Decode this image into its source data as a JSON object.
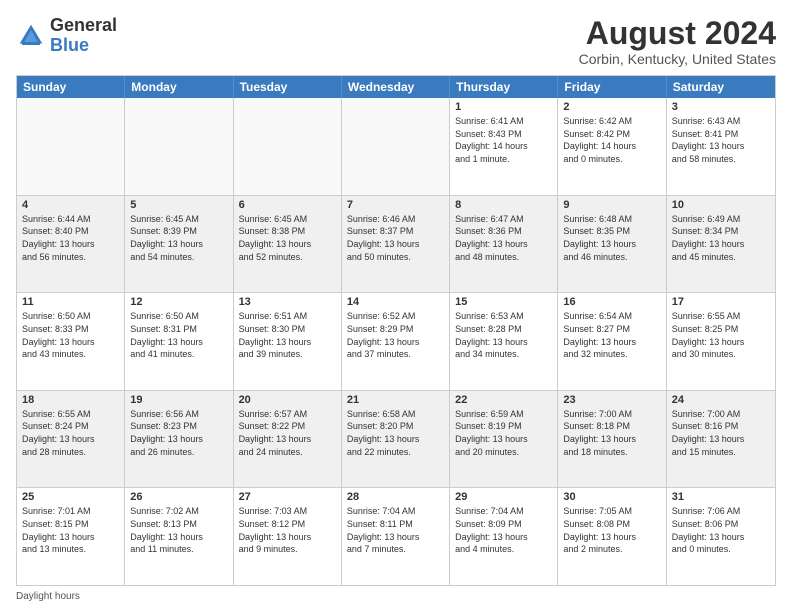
{
  "logo": {
    "general": "General",
    "blue": "Blue"
  },
  "header": {
    "month_year": "August 2024",
    "location": "Corbin, Kentucky, United States"
  },
  "days_of_week": [
    "Sunday",
    "Monday",
    "Tuesday",
    "Wednesday",
    "Thursday",
    "Friday",
    "Saturday"
  ],
  "weeks": [
    [
      {
        "day": "",
        "info": "",
        "empty": true
      },
      {
        "day": "",
        "info": "",
        "empty": true
      },
      {
        "day": "",
        "info": "",
        "empty": true
      },
      {
        "day": "",
        "info": "",
        "empty": true
      },
      {
        "day": "1",
        "info": "Sunrise: 6:41 AM\nSunset: 8:43 PM\nDaylight: 14 hours\nand 1 minute.",
        "empty": false
      },
      {
        "day": "2",
        "info": "Sunrise: 6:42 AM\nSunset: 8:42 PM\nDaylight: 14 hours\nand 0 minutes.",
        "empty": false
      },
      {
        "day": "3",
        "info": "Sunrise: 6:43 AM\nSunset: 8:41 PM\nDaylight: 13 hours\nand 58 minutes.",
        "empty": false
      }
    ],
    [
      {
        "day": "4",
        "info": "Sunrise: 6:44 AM\nSunset: 8:40 PM\nDaylight: 13 hours\nand 56 minutes.",
        "empty": false,
        "shaded": true
      },
      {
        "day": "5",
        "info": "Sunrise: 6:45 AM\nSunset: 8:39 PM\nDaylight: 13 hours\nand 54 minutes.",
        "empty": false,
        "shaded": true
      },
      {
        "day": "6",
        "info": "Sunrise: 6:45 AM\nSunset: 8:38 PM\nDaylight: 13 hours\nand 52 minutes.",
        "empty": false,
        "shaded": true
      },
      {
        "day": "7",
        "info": "Sunrise: 6:46 AM\nSunset: 8:37 PM\nDaylight: 13 hours\nand 50 minutes.",
        "empty": false,
        "shaded": true
      },
      {
        "day": "8",
        "info": "Sunrise: 6:47 AM\nSunset: 8:36 PM\nDaylight: 13 hours\nand 48 minutes.",
        "empty": false,
        "shaded": true
      },
      {
        "day": "9",
        "info": "Sunrise: 6:48 AM\nSunset: 8:35 PM\nDaylight: 13 hours\nand 46 minutes.",
        "empty": false,
        "shaded": true
      },
      {
        "day": "10",
        "info": "Sunrise: 6:49 AM\nSunset: 8:34 PM\nDaylight: 13 hours\nand 45 minutes.",
        "empty": false,
        "shaded": true
      }
    ],
    [
      {
        "day": "11",
        "info": "Sunrise: 6:50 AM\nSunset: 8:33 PM\nDaylight: 13 hours\nand 43 minutes.",
        "empty": false
      },
      {
        "day": "12",
        "info": "Sunrise: 6:50 AM\nSunset: 8:31 PM\nDaylight: 13 hours\nand 41 minutes.",
        "empty": false
      },
      {
        "day": "13",
        "info": "Sunrise: 6:51 AM\nSunset: 8:30 PM\nDaylight: 13 hours\nand 39 minutes.",
        "empty": false
      },
      {
        "day": "14",
        "info": "Sunrise: 6:52 AM\nSunset: 8:29 PM\nDaylight: 13 hours\nand 37 minutes.",
        "empty": false
      },
      {
        "day": "15",
        "info": "Sunrise: 6:53 AM\nSunset: 8:28 PM\nDaylight: 13 hours\nand 34 minutes.",
        "empty": false
      },
      {
        "day": "16",
        "info": "Sunrise: 6:54 AM\nSunset: 8:27 PM\nDaylight: 13 hours\nand 32 minutes.",
        "empty": false
      },
      {
        "day": "17",
        "info": "Sunrise: 6:55 AM\nSunset: 8:25 PM\nDaylight: 13 hours\nand 30 minutes.",
        "empty": false
      }
    ],
    [
      {
        "day": "18",
        "info": "Sunrise: 6:55 AM\nSunset: 8:24 PM\nDaylight: 13 hours\nand 28 minutes.",
        "empty": false,
        "shaded": true
      },
      {
        "day": "19",
        "info": "Sunrise: 6:56 AM\nSunset: 8:23 PM\nDaylight: 13 hours\nand 26 minutes.",
        "empty": false,
        "shaded": true
      },
      {
        "day": "20",
        "info": "Sunrise: 6:57 AM\nSunset: 8:22 PM\nDaylight: 13 hours\nand 24 minutes.",
        "empty": false,
        "shaded": true
      },
      {
        "day": "21",
        "info": "Sunrise: 6:58 AM\nSunset: 8:20 PM\nDaylight: 13 hours\nand 22 minutes.",
        "empty": false,
        "shaded": true
      },
      {
        "day": "22",
        "info": "Sunrise: 6:59 AM\nSunset: 8:19 PM\nDaylight: 13 hours\nand 20 minutes.",
        "empty": false,
        "shaded": true
      },
      {
        "day": "23",
        "info": "Sunrise: 7:00 AM\nSunset: 8:18 PM\nDaylight: 13 hours\nand 18 minutes.",
        "empty": false,
        "shaded": true
      },
      {
        "day": "24",
        "info": "Sunrise: 7:00 AM\nSunset: 8:16 PM\nDaylight: 13 hours\nand 15 minutes.",
        "empty": false,
        "shaded": true
      }
    ],
    [
      {
        "day": "25",
        "info": "Sunrise: 7:01 AM\nSunset: 8:15 PM\nDaylight: 13 hours\nand 13 minutes.",
        "empty": false
      },
      {
        "day": "26",
        "info": "Sunrise: 7:02 AM\nSunset: 8:13 PM\nDaylight: 13 hours\nand 11 minutes.",
        "empty": false
      },
      {
        "day": "27",
        "info": "Sunrise: 7:03 AM\nSunset: 8:12 PM\nDaylight: 13 hours\nand 9 minutes.",
        "empty": false
      },
      {
        "day": "28",
        "info": "Sunrise: 7:04 AM\nSunset: 8:11 PM\nDaylight: 13 hours\nand 7 minutes.",
        "empty": false
      },
      {
        "day": "29",
        "info": "Sunrise: 7:04 AM\nSunset: 8:09 PM\nDaylight: 13 hours\nand 4 minutes.",
        "empty": false
      },
      {
        "day": "30",
        "info": "Sunrise: 7:05 AM\nSunset: 8:08 PM\nDaylight: 13 hours\nand 2 minutes.",
        "empty": false
      },
      {
        "day": "31",
        "info": "Sunrise: 7:06 AM\nSunset: 8:06 PM\nDaylight: 13 hours\nand 0 minutes.",
        "empty": false
      }
    ]
  ],
  "footer": {
    "note": "Daylight hours"
  }
}
